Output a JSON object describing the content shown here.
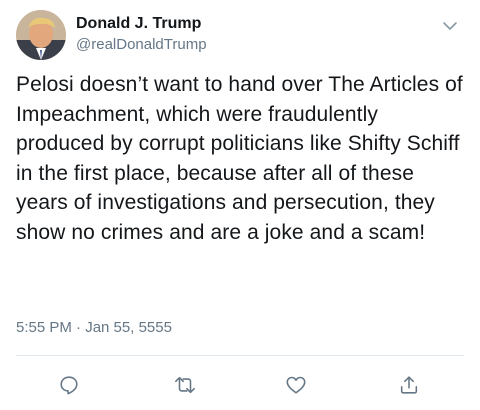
{
  "tweet": {
    "author": {
      "display_name": "Donald J. Trump",
      "handle": "@realDonaldTrump",
      "avatar_icon": "profile-photo"
    },
    "menu_icon": "chevron-down-icon",
    "text": "Pelosi doesn’t want to hand over The Articles of Impeachment, which were fraudulently produced by corrupt politicians like Shifty Schiff in the first place, because after all of these years of investigations and persecution, they show no crimes and are a joke and a scam!",
    "timestamp": "5:55 PM · Jan 55, 5555"
  },
  "actions": [
    {
      "name": "reply",
      "icon": "reply-icon"
    },
    {
      "name": "retweet",
      "icon": "retweet-icon"
    },
    {
      "name": "like",
      "icon": "heart-icon"
    },
    {
      "name": "share",
      "icon": "share-icon"
    }
  ],
  "colors": {
    "text_primary": "#14171a",
    "text_secondary": "#657786",
    "icon": "#657786",
    "divider": "#e1e8ed"
  }
}
